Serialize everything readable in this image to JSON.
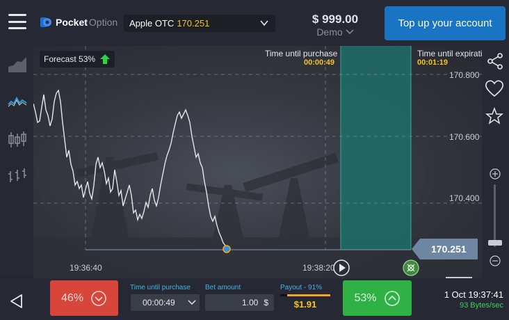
{
  "header": {
    "logo_brand": "Pocket",
    "logo_suffix": "Option",
    "asset_name": "Apple OTC",
    "asset_price": "170.251",
    "balance": "$ 999.00",
    "account_mode": "Demo",
    "topup_label": "Top up your account"
  },
  "chart": {
    "forecast_label": "Forecast 53%",
    "purchase_label": "Time until purchase",
    "purchase_time": "00:00:49",
    "expiration_label": "Time until expirati",
    "expiration_time": "00:01:19",
    "price_ticks": [
      "170.800",
      "170.600",
      "170.400"
    ],
    "time_ticks": [
      "19:36:40",
      "19:38:20"
    ],
    "current_price": "170.251",
    "colors": {
      "line": "#e4e6eb",
      "purchase_zone": "#1f6f6a",
      "price_tag": "#6d87a3",
      "forecast_arrow": "#2fd348"
    }
  },
  "bottom": {
    "down_percent": "46%",
    "time_label": "Time until purchase",
    "time_value": "00:00:49",
    "amount_label": "Bet amount",
    "amount_value": "1.00",
    "amount_currency": "$",
    "payout_label": "Payout - 91%",
    "payout_value": "$1.91",
    "up_percent": "53%",
    "datetime": "1 Oct 19:37:41",
    "speed": "93 Bytes/sec"
  },
  "icons": {
    "left_tools": [
      "area-chart-icon",
      "line-chart-icon",
      "candles-icon",
      "bars-icon"
    ],
    "right_tools": [
      "share-icon",
      "heart-icon",
      "star-icon",
      "zoom-in-icon",
      "zoom-out-icon"
    ]
  }
}
